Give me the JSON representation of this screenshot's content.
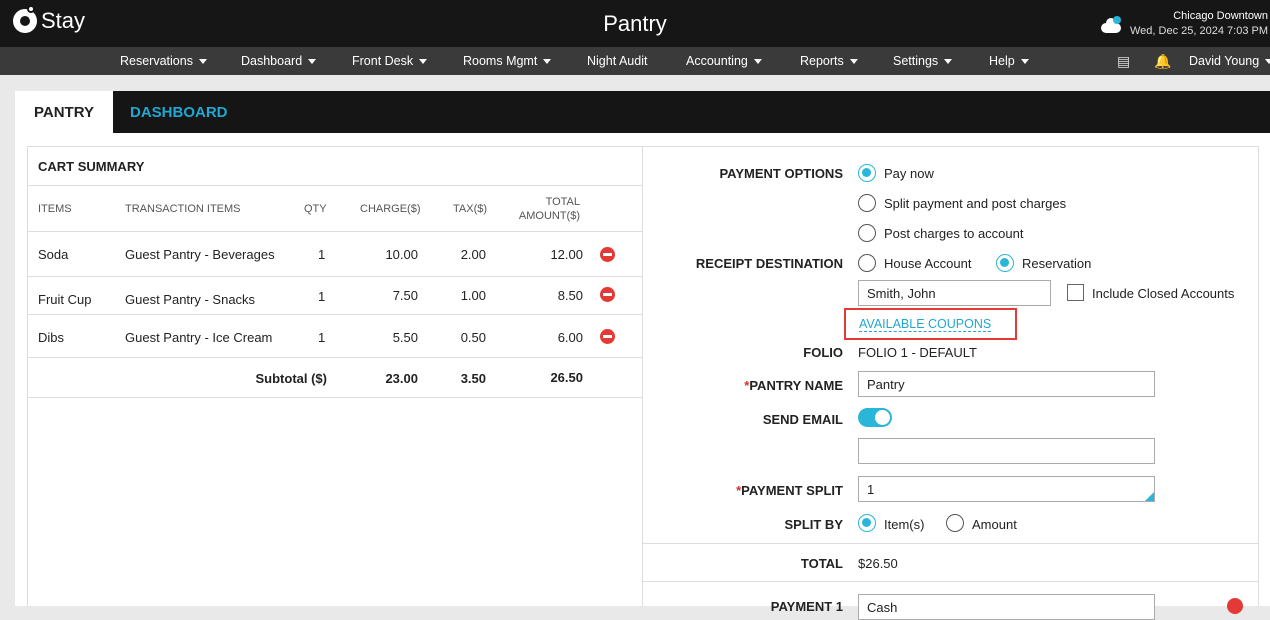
{
  "header": {
    "logo_text": "Stay",
    "title": "Pantry",
    "location": "Chicago Downtown",
    "datetime": "Wed, Dec 25, 2024 7:03 PM"
  },
  "nav": {
    "items": [
      "Reservations",
      "Dashboard",
      "Front Desk",
      "Rooms Mgmt",
      "Night Audit",
      "Accounting",
      "Reports",
      "Settings",
      "Help"
    ],
    "user": "David Young"
  },
  "tabs": [
    "PANTRY",
    "DASHBOARD"
  ],
  "cart": {
    "title": "CART SUMMARY",
    "columns": [
      "ITEMS",
      "TRANSACTION ITEMS",
      "QTY",
      "CHARGE($)",
      "TAX($)",
      "TOTAL",
      "AMOUNT($)"
    ],
    "rows": [
      {
        "item": "Soda",
        "trans": "Guest Pantry - Beverages",
        "qty": "1",
        "charge": "10.00",
        "tax": "2.00",
        "total": "12.00"
      },
      {
        "item": "Fruit Cup",
        "trans": "Guest Pantry - Snacks",
        "qty": "1",
        "charge": "7.50",
        "tax": "1.00",
        "total": "8.50"
      },
      {
        "item": "Dibs",
        "trans": "Guest Pantry - Ice Cream",
        "qty": "1",
        "charge": "5.50",
        "tax": "0.50",
        "total": "6.00"
      }
    ],
    "subtotal_label": "Subtotal ($)",
    "subtotal_charge": "23.00",
    "subtotal_tax": "3.50",
    "subtotal_total": "26.50"
  },
  "payment": {
    "options_label": "PAYMENT OPTIONS",
    "options": [
      "Pay now",
      "Split payment and post charges",
      "Post charges to account"
    ],
    "receipt_label": "RECEIPT DESTINATION",
    "receipt_options": [
      "House Account",
      "Reservation"
    ],
    "guest_value": "Smith, John",
    "include_closed": "Include Closed Accounts",
    "coupons": "AVAILABLE COUPONS",
    "folio_label": "FOLIO",
    "folio_value": "FOLIO 1 - DEFAULT",
    "pantry_name_label": "PANTRY NAME",
    "pantry_name_value": "Pantry",
    "send_email_label": "SEND EMAIL",
    "email_value": "",
    "payment_split_label": "PAYMENT SPLIT",
    "payment_split_value": "1",
    "split_by_label": "SPLIT BY",
    "split_by_options": [
      "Item(s)",
      "Amount"
    ],
    "total_label": "TOTAL",
    "total_value": "$26.50",
    "payment1_label": "PAYMENT 1",
    "payment1_value": "Cash"
  }
}
